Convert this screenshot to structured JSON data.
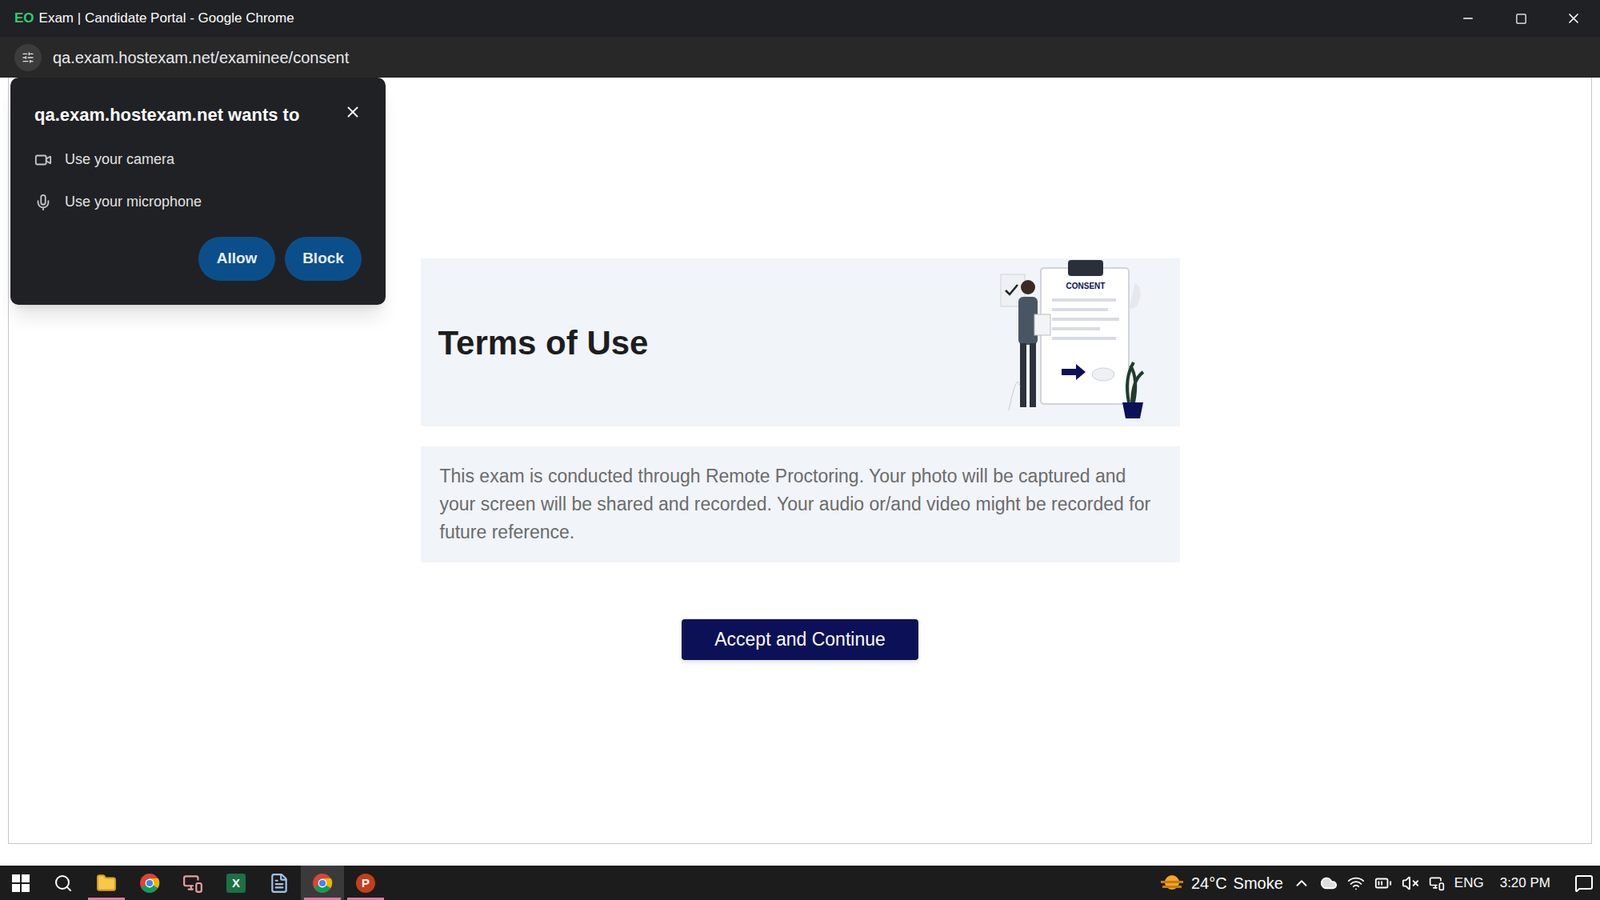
{
  "window": {
    "title": "Exam | Candidate Portal - Google Chrome",
    "logo": "EO"
  },
  "address_bar": {
    "url": "qa.exam.hostexam.net/examinee/consent"
  },
  "permission_prompt": {
    "title": "qa.exam.hostexam.net wants to",
    "permissions": [
      {
        "label": "Use your camera",
        "kind": "camera"
      },
      {
        "label": "Use your microphone",
        "kind": "microphone"
      }
    ],
    "buttons": [
      "Allow",
      "Block"
    ]
  },
  "consent": {
    "title": "Terms of Use",
    "illustration_label": "CONSENT",
    "description": "This exam is conducted through Remote Proctoring. Your photo will be captured and your screen will be shared and recorded. Your audio or/and video might be recorded for future reference.",
    "button": "Accept and Continue"
  },
  "taskbar": {
    "apps": [
      {
        "kind": "explorer",
        "open": true,
        "focused": false,
        "glyph": ""
      },
      {
        "kind": "chrome",
        "open": false,
        "focused": false,
        "glyph": ""
      },
      {
        "kind": "paint",
        "open": false,
        "focused": false,
        "glyph": ""
      },
      {
        "kind": "excel",
        "open": false,
        "focused": false,
        "glyph": "X"
      },
      {
        "kind": "notepad",
        "open": false,
        "focused": false,
        "glyph": ""
      },
      {
        "kind": "chrome",
        "open": true,
        "focused": true,
        "glyph": ""
      },
      {
        "kind": "powerpoint",
        "open": true,
        "focused": false,
        "glyph": "P"
      }
    ]
  },
  "tray": {
    "temperature": "24°C",
    "weather": "Smoke",
    "language": "ENG",
    "time": "3:20 PM"
  }
}
